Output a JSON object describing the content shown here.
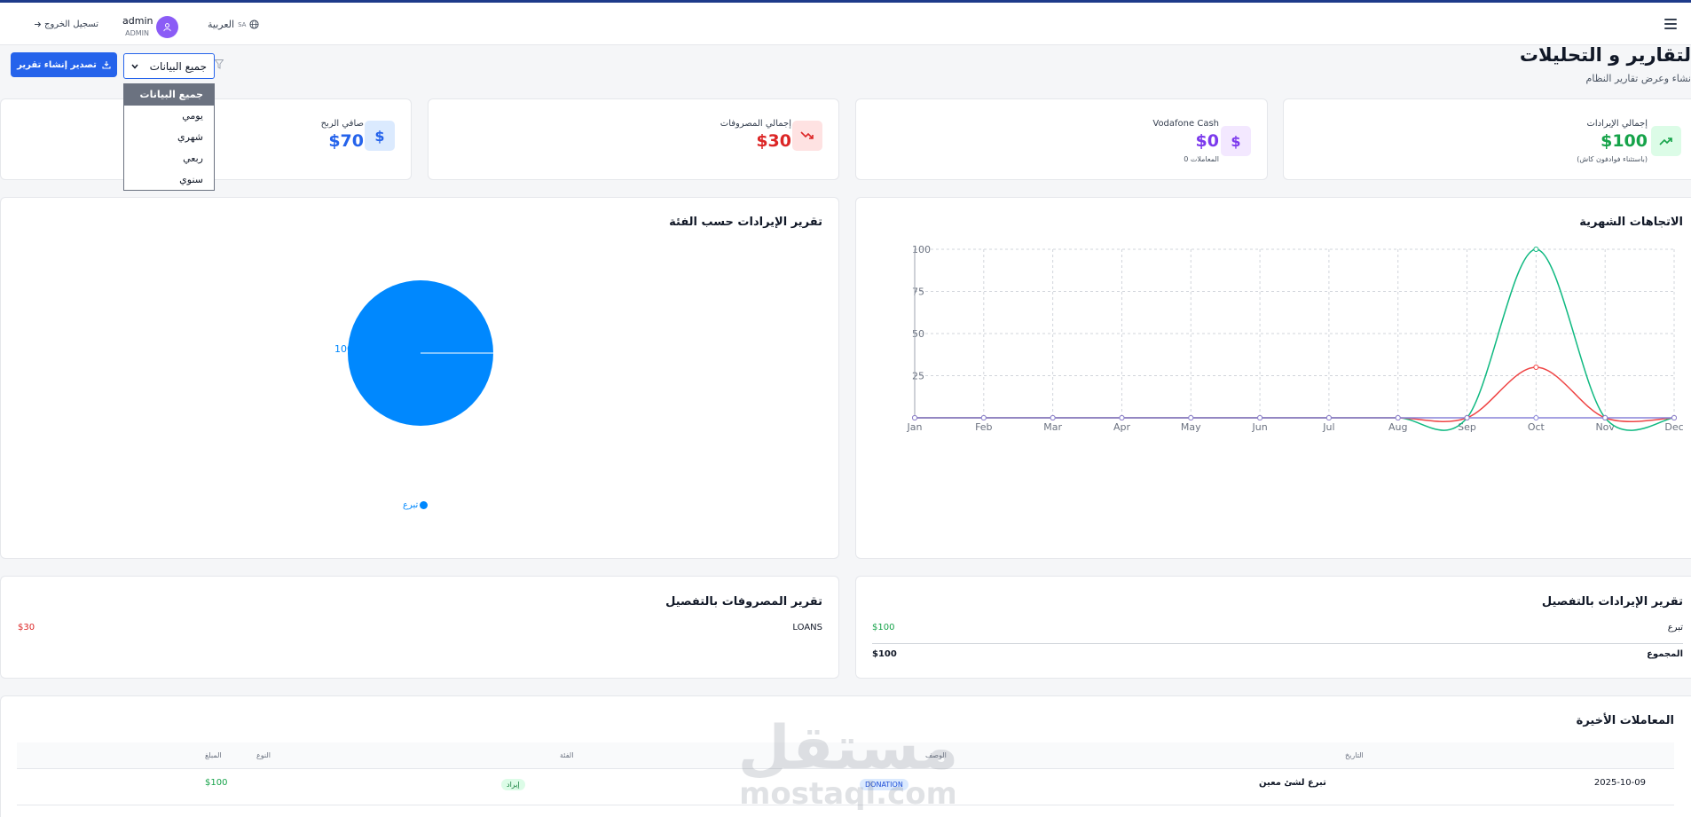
{
  "header": {
    "language": "العربية",
    "language_code": "SA",
    "user_name": "admin",
    "user_role": "ADMIN",
    "logout_label": "تسجيل الخروج"
  },
  "page": {
    "title": "لتقارير و التحليلات",
    "subtitle": "نشاء وعرض تقارير النظام"
  },
  "toolbar": {
    "export_label": "تصدير إنشاء تقرير",
    "filter_selected": "جميع البيانات",
    "filter_options": [
      "جميع البيانات",
      "يومي",
      "شهري",
      "ربعي",
      "سنوي"
    ]
  },
  "stats": {
    "revenue": {
      "title": "إجمالي الإيرادات",
      "value": "$100",
      "note": "(باستثناء فوادفون كاش)"
    },
    "vodafone": {
      "title": "Vodafone Cash",
      "value": "$0",
      "note": "0 المعاملات"
    },
    "expenses": {
      "title": "إجمالي المصروفات",
      "value": "$30"
    },
    "profit": {
      "title": "صافي الربح",
      "value": "$70"
    }
  },
  "colors": {
    "revenue": "#16a34a",
    "expenses": "#dc2626",
    "vodafone": "#7c3aed",
    "profit": "#2563eb",
    "pie": "#0088fe",
    "line_green": "#10b981",
    "line_red": "#ef4444",
    "line_purple": "#8884d8"
  },
  "monthly": {
    "title": "الاتجاهات الشهرية"
  },
  "category": {
    "title": "تقرير الإيرادات حسب الفئة",
    "legend": "تبرع",
    "slice_label": "100"
  },
  "chart_data": [
    {
      "type": "line",
      "title": "الاتجاهات الشهرية",
      "categories": [
        "Jan",
        "Feb",
        "Mar",
        "Apr",
        "May",
        "Jun",
        "Jul",
        "Aug",
        "Sep",
        "Oct",
        "Nov",
        "Dec"
      ],
      "series": [
        {
          "color": "#10b981",
          "values": [
            0,
            0,
            0,
            0,
            0,
            0,
            0,
            0,
            0,
            100,
            0,
            0
          ]
        },
        {
          "color": "#ef4444",
          "values": [
            0,
            0,
            0,
            0,
            0,
            0,
            0,
            0,
            0,
            30,
            0,
            0
          ]
        },
        {
          "color": "#8884d8",
          "values": [
            0,
            0,
            0,
            0,
            0,
            0,
            0,
            0,
            0,
            0,
            0,
            0
          ]
        }
      ],
      "yticks": [
        "0",
        "25",
        "50",
        "75",
        "100"
      ],
      "ylim": [
        0,
        100
      ],
      "grid": true
    },
    {
      "type": "pie",
      "title": "تقرير الإيرادات حسب الفئة",
      "labels": [
        "تبرع"
      ],
      "values": [
        100
      ],
      "colors": [
        "#0088fe"
      ]
    }
  ],
  "revenue_detail": {
    "title": "تقرير الإيرادات بالتفصيل",
    "rows": [
      {
        "label": "تبرع",
        "value": "$100"
      }
    ],
    "total_label": "المجموع",
    "total_value": "$100"
  },
  "expense_detail": {
    "title": "تقرير المصروفات بالتفصيل",
    "rows": [
      {
        "label": "LOANS",
        "value": "$30"
      }
    ]
  },
  "transactions": {
    "title": "المعاملات الأخيرة",
    "headers": {
      "date": "التاريخ",
      "description": "الوصف",
      "category": "الفئة",
      "type": "النوع",
      "amount": "المبلغ"
    },
    "rows": [
      {
        "date": "2025-10-09",
        "description": "تبرع لشئ معين",
        "category": "DONATION",
        "type": "إيراد",
        "amount": "$100"
      }
    ]
  },
  "watermark": {
    "text_ar": "مستقل",
    "text_en": "mostaql.com"
  }
}
